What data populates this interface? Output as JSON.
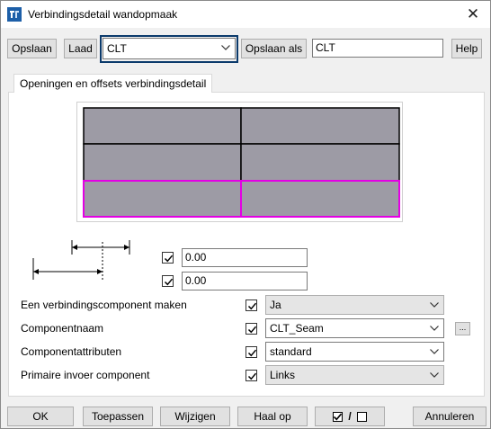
{
  "window": {
    "title": "Verbindingsdetail wandopmaak",
    "close_glyph": "✕"
  },
  "toolbar": {
    "save_label": "Opslaan",
    "load_label": "Laad",
    "preset_value": "CLT",
    "save_as_label": "Opslaan als",
    "save_as_value": "CLT",
    "help_label": "Help"
  },
  "tab": {
    "label": "Openingen en offsets verbindingsdetail"
  },
  "offsets": {
    "offset_top_value": "0.00",
    "offset_bottom_value": "0.00"
  },
  "fields": [
    {
      "label": "Een verbindingscomponent maken",
      "value": "Ja",
      "style": "gray"
    },
    {
      "label": "Componentnaam",
      "value": "CLT_Seam",
      "style": "white"
    },
    {
      "label": "Componentattributen",
      "value": "standard",
      "style": "white"
    },
    {
      "label": "Primaire invoer component",
      "value": "Links",
      "style": "gray"
    }
  ],
  "browse_glyph": "...",
  "footer": {
    "ok_label": "OK",
    "apply_label": "Toepassen",
    "modify_label": "Wijzigen",
    "get_label": "Haal op",
    "toggle_separator": "/",
    "cancel_label": "Annuleren"
  },
  "colors": {
    "panel_fill": "#9d9ba5",
    "highlight": "#e400e4",
    "focus_border": "#0b3a6b"
  },
  "icons": {
    "app": "tekla-app-icon",
    "close": "close-icon",
    "chevron": "chevron-down-icon",
    "check": "checkmark-icon"
  }
}
